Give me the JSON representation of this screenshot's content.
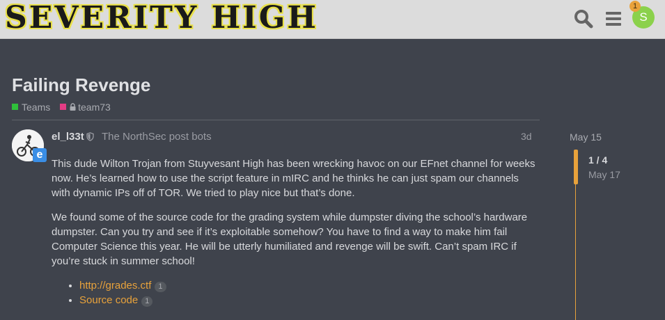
{
  "header": {
    "logo_text": "SEVERITY HIGH",
    "notification_count": "1",
    "user_initial": "S"
  },
  "topic": {
    "title": "Failing Revenge",
    "tags": [
      {
        "label": "Teams",
        "color": "#2fbf3a"
      },
      {
        "label": "team73",
        "color": "#e43c84",
        "locked": true
      }
    ]
  },
  "post": {
    "username": "el_l33t",
    "group": "The NorthSec post bots",
    "date": "3d",
    "badge": "e",
    "paragraphs": [
      "This dude Wilton Trojan from Stuyvesant High has been wrecking havoc on our EFnet channel for weeks now. He’s learned how to use the script feature in mIRC and he thinks he can just spam our channels with dynamic IPs off of TOR. We tried to play nice but that’s done.",
      "We found some of the source code for the grading system while dumpster diving the school’s hardware dumpster. Can you try and see if it’s exploitable somehow? You have to find a way to make him fail Computer Science this year. He will be utterly humiliated and revenge will be swift. Can’t spam IRC if you’re stuck in summer school!"
    ],
    "links": [
      {
        "label": "http://grades.ctf",
        "count": "1"
      },
      {
        "label": "Source code",
        "count": "1"
      }
    ]
  },
  "timeline": {
    "start_date": "May 15",
    "position": "1 / 4",
    "current_date": "May 17",
    "accent": "#e8a23b"
  }
}
